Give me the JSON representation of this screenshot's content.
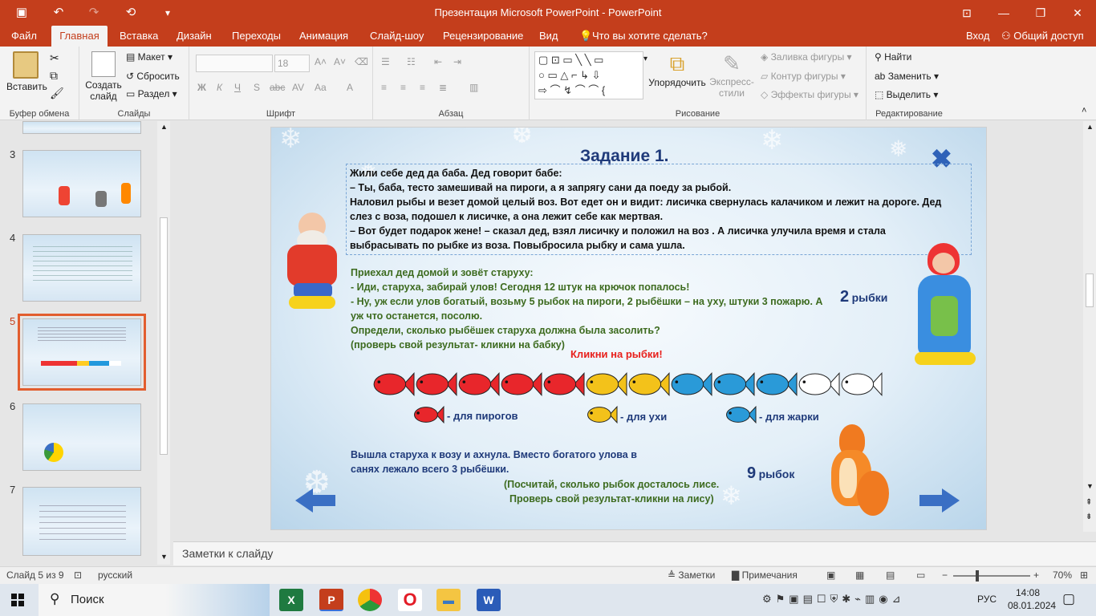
{
  "titlebar": {
    "title": "Презентация Microsoft PowerPoint - PowerPoint"
  },
  "tabs": [
    "Файл",
    "Главная",
    "Вставка",
    "Дизайн",
    "Переходы",
    "Анимация",
    "Слайд-шоу",
    "Рецензирование",
    "Вид"
  ],
  "tell_me": "Что вы хотите сделать?",
  "signin": "Вход",
  "share": "Общий доступ",
  "ribbon": {
    "clipboard": {
      "paste": "Вставить",
      "label": "Буфер обмена"
    },
    "slides": {
      "new_slide": "Создать",
      "new_slide2": "слайд",
      "layout": "Макет",
      "reset": "Сбросить",
      "section": "Раздел",
      "label": "Слайды"
    },
    "font": {
      "size": "18",
      "label": "Шрифт",
      "bold": "Ж",
      "italic": "К",
      "underline": "Ч",
      "shadow": "S",
      "strike": "abc",
      "spacing": "AV",
      "case": "Aa"
    },
    "paragraph": {
      "label": "Абзац"
    },
    "drawing": {
      "arrange": "Упорядочить",
      "quick_styles": "Экспресс-",
      "quick_styles2": "стили",
      "fill": "Заливка фигуры",
      "outline": "Контур фигуры",
      "effects": "Эффекты фигуры",
      "label": "Рисование"
    },
    "editing": {
      "find": "Найти",
      "replace": "Заменить",
      "select": "Выделить",
      "label": "Редактирование"
    }
  },
  "thumbnails": [
    {
      "num": "3"
    },
    {
      "num": "4"
    },
    {
      "num": "5"
    },
    {
      "num": "6"
    },
    {
      "num": "7"
    }
  ],
  "slide": {
    "title": "Задание  1.",
    "story": [
      "Жили себе дед да баба. Дед говорит бабе:",
      "– Ты, баба, тесто замешивай на пироги, а я запрягу сани да поеду за рыбой.",
      "Наловил рыбы и везет домой целый воз. Вот едет он и видит: лисичка свернулась калачиком и лежит на дороге. Дед",
      "слез с воза, подошел к лисичке, а она  лежит себе как мертвая.",
      "– Вот будет подарок жене! – сказал дед, взял лисичку и положил на воз . А лисичка улучила время и стала",
      "выбрасывать по рыбке   из воза. Повыбросила  рыбку и сама ушла."
    ],
    "task": [
      "Приехал дед домой и зовёт старуху:",
      "- Иди, старуха, забирай улов! Сегодня 12 штук на крючок попалось!",
      "- Ну, уж если улов богатый, возьму 5 рыбок на пироги, 2 рыбёшки – на уху, штуки 3 пожарю. А",
      "уж что останется, посолю.",
      "Определи, сколько рыбёшек старуха должна была засолить?",
      "(проверь свой результат- кликни на бабку)"
    ],
    "answer_granny": {
      "num": "2",
      "word": "рыбки"
    },
    "click_fish": "Кликни на рыбки!",
    "fish_row": [
      "red",
      "red",
      "red",
      "red",
      "red",
      "yellow",
      "yellow",
      "blue",
      "blue",
      "blue",
      "white",
      "white"
    ],
    "legend": [
      {
        "color": "red",
        "text": "- для пирогов"
      },
      {
        "color": "yellow",
        "text": "- для ухи"
      },
      {
        "color": "blue",
        "text": "- для жарки"
      }
    ],
    "ending": [
      "Вышла старуха к возу и ахнула. Вместо богатого улова в",
      "санях лежало всего 3 рыбёшки."
    ],
    "fox_task": [
      "(Посчитай, сколько рыбок досталось лисе.",
      "Проверь свой результат-кликни на лису)"
    ],
    "answer_fox": {
      "num": "9",
      "word": "рыбок"
    },
    "colors": {
      "red": "#e8262b",
      "yellow": "#f3c21a",
      "blue": "#2a9ad8",
      "white": "#ffffff"
    }
  },
  "notes_placeholder": "Заметки к слайду",
  "status": {
    "slide_of": "Слайд 5 из 9",
    "lang": "русский",
    "notes": "Заметки",
    "comments": "Примечания",
    "zoom": "70%"
  },
  "taskbar": {
    "search": "Поиск",
    "lang": "РУС",
    "time": "14:08",
    "date": "08.01.2024"
  }
}
